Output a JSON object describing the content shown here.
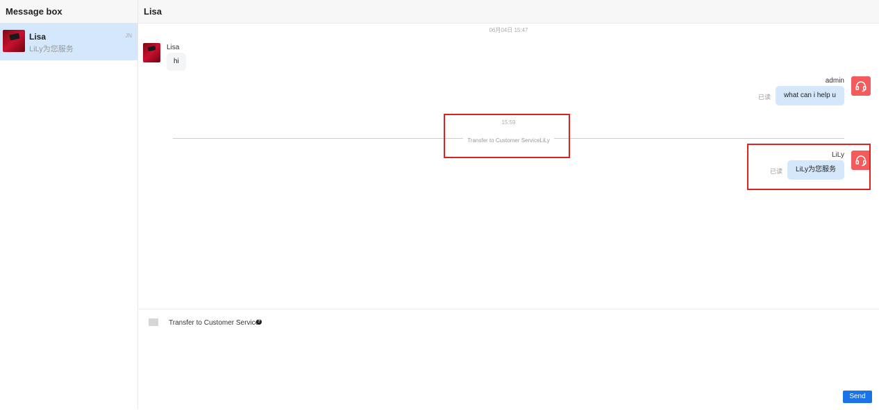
{
  "sidebar": {
    "title": "Message box",
    "conversations": [
      {
        "name": "Lisa",
        "preview": "LiLy为您服务",
        "badge": "JN"
      }
    ]
  },
  "chat": {
    "title": "Lisa",
    "time_1": "06月04日 15:47",
    "time_2": "15:59",
    "messages": [
      {
        "sender": "Lisa",
        "text": "hi",
        "direction": "in"
      },
      {
        "sender": "admin",
        "text": "what can i help u",
        "direction": "out",
        "status": "已读"
      },
      {
        "sender": "LiLy",
        "text": "LiLy为您服务",
        "direction": "out",
        "status": "已读"
      }
    ],
    "system_notice": "Transfer to Customer ServiceLiLy"
  },
  "input": {
    "transfer_label": "Transfer to Customer Service",
    "help_glyph": "?",
    "send_label": "Send"
  },
  "colors": {
    "accent": "#1a73e8",
    "agent_avatar": "#f25c5c",
    "selected_bg": "#d5e8fb",
    "highlight": "#e02020"
  },
  "icons": [
    "image-icon",
    "help-icon",
    "headset-icon"
  ]
}
